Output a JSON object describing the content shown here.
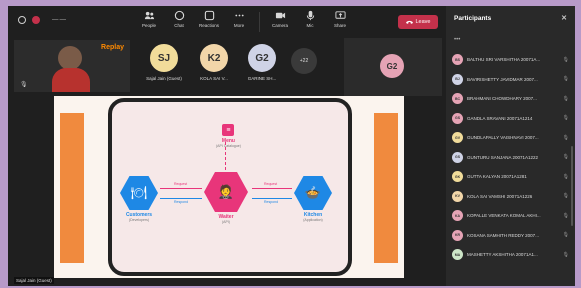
{
  "toolbar": {
    "people": "People",
    "chat": "Chat",
    "reactions": "Reactions",
    "more": "More",
    "camera": "Camera",
    "mic": "Mic",
    "share": "Share",
    "leave": "Leave"
  },
  "strip": {
    "camera_logo": "Replay",
    "tiles": [
      {
        "initials": "SJ",
        "label": "Sajal Jain (Guest)",
        "color": "#f1dc9a"
      },
      {
        "initials": "K2",
        "label": "KOLA SAI V...",
        "color": "#f2d6a9"
      },
      {
        "initials": "G2",
        "label": "GARINE SH...",
        "color": "#cfd3e6"
      }
    ],
    "more_count": "+22",
    "big_tile_initials": "G2",
    "presenter_caption": "Sajal Jain (Guest)"
  },
  "slide": {
    "menu": "Menu",
    "menu_sub": "(API Catalogue)",
    "customers": "Customers",
    "customers_sub": "(Developers)",
    "waiter": "Waiter",
    "waiter_sub": "(API)",
    "kitchen": "Kitchen",
    "kitchen_sub": "(Application)",
    "request": "Request",
    "respond": "Respond"
  },
  "panel": {
    "title": "Participants",
    "participants": [
      {
        "initials": "BS",
        "name": "BALTHU SRI VARSHITHA 20071A...",
        "color": "#e5a3b5"
      },
      {
        "initials": "BJ",
        "name": "BAVIRISHETTY JAVIDMAR 2007...",
        "color": "#cfd3e6"
      },
      {
        "initials": "BC",
        "name": "BRAHMANI CHOWDHARY 2007...",
        "color": "#e5a3b5"
      },
      {
        "initials": "GS",
        "name": "GANDLA SRAVANI 20071A1214",
        "color": "#e5a3b5"
      },
      {
        "initials": "GV",
        "name": "GUNDLAPALLY VAISHNAVI 2007...",
        "color": "#f1dc9a"
      },
      {
        "initials": "GS",
        "name": "GUNTURU SANJANA 20071A1222",
        "color": "#cfd3e6"
      },
      {
        "initials": "GK",
        "name": "GUTTA KALYAN 20071A1281",
        "color": "#f1dc9a"
      },
      {
        "initials": "KV",
        "name": "KOLA SAI VAMSHI 20071A1226",
        "color": "#f2d6a9"
      },
      {
        "initials": "KA",
        "name": "KOPALLE VENKATA KOMAL AKHI...",
        "color": "#e5a3b5"
      },
      {
        "initials": "KR",
        "name": "KOSANA SAMHITH REDDY 2007...",
        "color": "#e5a3b5"
      },
      {
        "initials": "MA",
        "name": "MASHETTY AKSHITHA 20071A1...",
        "color": "#cde6c8"
      }
    ]
  }
}
